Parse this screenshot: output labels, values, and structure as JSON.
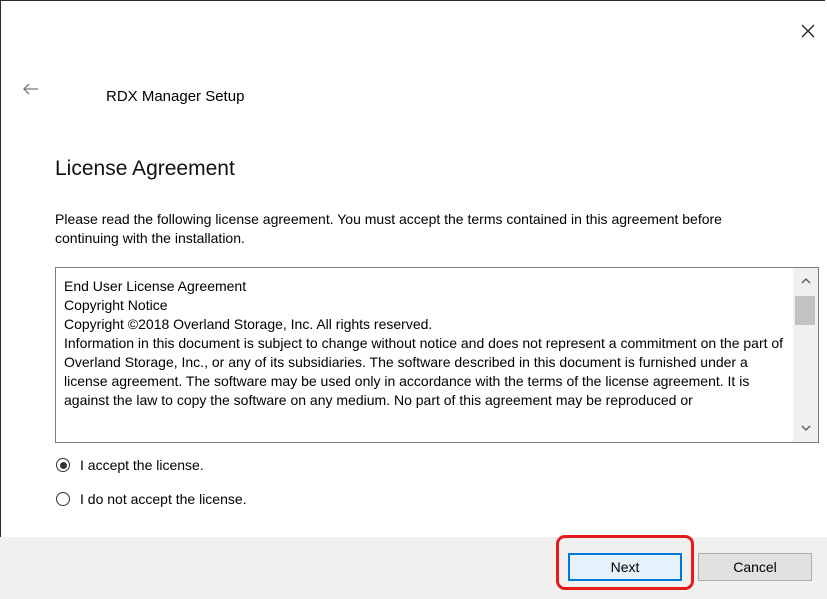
{
  "window": {
    "title": "RDX Manager Setup",
    "close_icon": "close-icon",
    "back_icon": "back-arrow-icon"
  },
  "page": {
    "heading": "License Agreement",
    "intro": "Please read the following license agreement. You must accept the terms contained in this agreement before continuing with the installation."
  },
  "license": {
    "text": "End User License Agreement\nCopyright Notice\nCopyright ©2018 Overland Storage, Inc. All rights reserved.\nInformation in this document is subject to change without notice and does not represent a commitment on the part of Overland Storage, Inc., or any of its subsidiaries. The software described in this document is furnished under a license agreement. The software may be used only in accordance with the terms of the license agreement. It is against the law to copy the software on any medium. No part of this agreement may be reproduced or",
    "scroll_up_icon": "chevron-up-icon",
    "scroll_down_icon": "chevron-down-icon"
  },
  "options": [
    {
      "label": "I accept the license.",
      "selected": true
    },
    {
      "label": "I do not accept the license.",
      "selected": false
    }
  ],
  "footer": {
    "next_label": "Next",
    "cancel_label": "Cancel",
    "highlight_color": "#e41b1b"
  }
}
